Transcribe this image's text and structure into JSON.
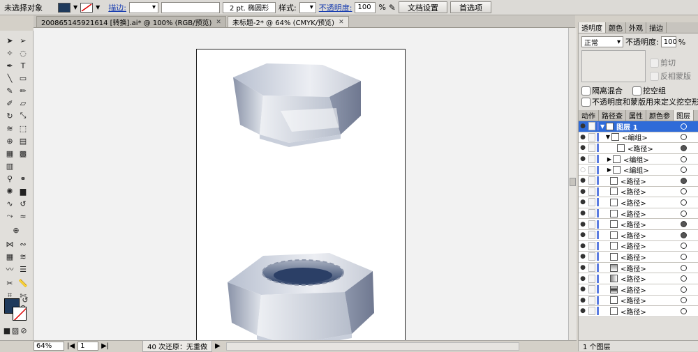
{
  "control_bar": {
    "selection": "未选择对象",
    "stroke_link": "描边:",
    "stroke_weight": "2 pt. 椭圆形",
    "style_label": "样式:",
    "opacity_link": "不透明度:",
    "opacity_value": "100",
    "opacity_unit": "%",
    "doc_settings": "文档设置",
    "preferences": "首选项",
    "fill_color": "#1f3a5c"
  },
  "tabs": [
    {
      "label": "200865145921614 [转换].ai* @ 100% (RGB/预览)"
    },
    {
      "label": "未标题-2* @ 64% (CMYK/预览)"
    }
  ],
  "status": {
    "zoom": "64%",
    "page": "1",
    "undo": "40 次还原：无重做"
  },
  "panel": {
    "top_tabs": [
      "透明度",
      "颜色",
      "外观",
      "描边"
    ],
    "blend_mode": "正常",
    "opacity_label": "不透明度:",
    "opacity_value": "100",
    "opacity_unit": "%",
    "clip_label": "剪切",
    "invert_label": "反相蒙版",
    "isolate_label": "隔离混合",
    "knockout_label": "挖空组",
    "mask_label": "不透明度和蒙版用来定义挖空形状",
    "layer_tabs": [
      "动作",
      "路径查",
      "属性",
      "颜色参",
      "图层"
    ],
    "layers": [
      {
        "name": "图层 1"
      },
      {
        "name": "<编组>"
      },
      {
        "name": "<路径>"
      },
      {
        "name": "<编组>"
      },
      {
        "name": "<编组>"
      },
      {
        "name": "<路径>"
      },
      {
        "name": "<路径>"
      },
      {
        "name": "<路径>"
      },
      {
        "name": "<路径>"
      },
      {
        "name": "<路径>"
      },
      {
        "name": "<路径>"
      },
      {
        "name": "<路径>"
      },
      {
        "name": "<路径>"
      },
      {
        "name": "<路径>"
      },
      {
        "name": "<路径>"
      },
      {
        "name": "<路径>"
      },
      {
        "name": "<路径>"
      },
      {
        "name": "<路径>"
      }
    ],
    "footer": "1 个图层"
  }
}
